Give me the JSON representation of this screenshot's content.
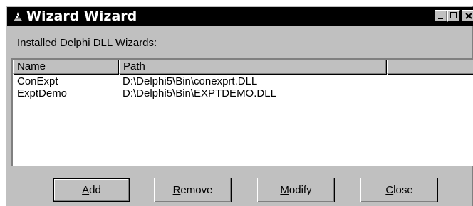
{
  "window": {
    "title": "Wizard Wizard",
    "icon": "wizard-hat-icon"
  },
  "caption_buttons": {
    "minimize": "minimize-icon",
    "maximize": "maximize-icon",
    "close": "close-icon"
  },
  "heading": "Installed Delphi DLL Wizards:",
  "list": {
    "columns": [
      "Name",
      "Path",
      ""
    ],
    "rows": [
      {
        "name": "ConExpt",
        "path": "D:\\Delphi5\\Bin\\conexprt.DLL"
      },
      {
        "name": "ExptDemo",
        "path": "D:\\Delphi5\\Bin\\EXPTDEMO.DLL"
      }
    ]
  },
  "buttons": {
    "add": {
      "mnemonic": "A",
      "rest": "dd"
    },
    "remove": {
      "mnemonic": "R",
      "rest": "emove"
    },
    "modify": {
      "mnemonic": "M",
      "rest": "odify"
    },
    "close": {
      "mnemonic": "C",
      "rest": "lose"
    }
  },
  "colors": {
    "face": "#c0c0c0",
    "titlebar": "#000000",
    "list_bg": "#ffffff"
  }
}
